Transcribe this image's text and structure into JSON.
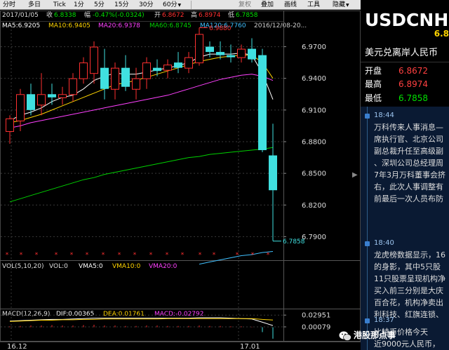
{
  "toolbar": {
    "items": [
      "分时",
      "多日",
      "Tick",
      "1分",
      "5分",
      "15分",
      "30分",
      "60分",
      "复权",
      "叠加",
      "画线",
      "工具",
      "隐藏"
    ]
  },
  "ohlc": {
    "date": "2017/01/05",
    "close_label": "收",
    "close": "6.8338",
    "change_label": "幅",
    "change": "-0.47%(-0.0324)",
    "open_label": "开",
    "open": "6.8672",
    "high_label": "高",
    "high": "6.8974",
    "low_label": "低",
    "low": "6.7858"
  },
  "ma": {
    "ma5": "MA5:6.9205",
    "ma10": "MA10:6.9405",
    "ma20": "MA20:6.9378",
    "ma60": "MA60:6.8745",
    "ma120": "MA120:6.7760",
    "range": "2016/12/08-20..."
  },
  "vol": {
    "title": "VOL(5,10,20)",
    "vol": "VOL:0",
    "vma5": "VMA5:0",
    "vma10": "VMA10:0",
    "vma20": "VMA20:0"
  },
  "macd": {
    "title": "MACD(12,26,9)",
    "dif": "DIF:0.00365",
    "dea": "DEA:0.01761",
    "macd": "MACD:-0.02792"
  },
  "colors": {
    "up": "#ff3030",
    "down": "#40e0e0",
    "ma5": "#ffffff",
    "ma10": "#ffd400",
    "ma20": "#ff40ff",
    "ma60": "#00d000",
    "ma120": "#40c0ff"
  },
  "chart_data": {
    "type": "candlestick",
    "price_axis_ticks": [
      "6.9700",
      "6.9400",
      "6.9100",
      "6.8800",
      "6.8500",
      "6.8200",
      "6.7900"
    ],
    "ylim": [
      6.775,
      6.985
    ],
    "macd_axis_ticks": [
      "0.02951",
      "0.00079"
    ],
    "x_labels": [
      "16.12",
      "17.01"
    ],
    "annotations": [
      {
        "text": "6.9880",
        "value": 6.988,
        "kind": "high"
      },
      {
        "text": "6.7858",
        "value": 6.7858,
        "kind": "low"
      }
    ],
    "candles": [
      {
        "o": 6.89,
        "h": 6.905,
        "l": 6.878,
        "c": 6.902
      },
      {
        "o": 6.9,
        "h": 6.93,
        "l": 6.89,
        "c": 6.925
      },
      {
        "o": 6.925,
        "h": 6.935,
        "l": 6.905,
        "c": 6.91
      },
      {
        "o": 6.915,
        "h": 6.945,
        "l": 6.905,
        "c": 6.925
      },
      {
        "o": 6.925,
        "h": 6.935,
        "l": 6.915,
        "c": 6.922
      },
      {
        "o": 6.922,
        "h": 6.932,
        "l": 6.915,
        "c": 6.925
      },
      {
        "o": 6.925,
        "h": 6.945,
        "l": 6.918,
        "c": 6.94
      },
      {
        "o": 6.94,
        "h": 6.96,
        "l": 6.935,
        "c": 6.955
      },
      {
        "o": 6.945,
        "h": 6.975,
        "l": 6.935,
        "c": 6.97
      },
      {
        "o": 6.95,
        "h": 6.968,
        "l": 6.92,
        "c": 6.93
      },
      {
        "o": 6.93,
        "h": 6.955,
        "l": 6.92,
        "c": 6.95
      },
      {
        "o": 6.95,
        "h": 6.962,
        "l": 6.928,
        "c": 6.932
      },
      {
        "o": 6.93,
        "h": 6.95,
        "l": 6.92,
        "c": 6.94
      },
      {
        "o": 6.94,
        "h": 6.96,
        "l": 6.93,
        "c": 6.955
      },
      {
        "o": 6.95,
        "h": 6.958,
        "l": 6.942,
        "c": 6.947
      },
      {
        "o": 6.948,
        "h": 6.958,
        "l": 6.94,
        "c": 6.953
      },
      {
        "o": 6.955,
        "h": 6.965,
        "l": 6.945,
        "c": 6.95
      },
      {
        "o": 6.95,
        "h": 6.965,
        "l": 6.945,
        "c": 6.96
      },
      {
        "o": 6.955,
        "h": 6.988,
        "l": 6.952,
        "c": 6.982
      },
      {
        "o": 6.97,
        "h": 6.975,
        "l": 6.96,
        "c": 6.965
      },
      {
        "o": 6.965,
        "h": 6.975,
        "l": 6.958,
        "c": 6.962
      },
      {
        "o": 6.962,
        "h": 6.972,
        "l": 6.955,
        "c": 6.96
      },
      {
        "o": 6.96,
        "h": 6.972,
        "l": 6.955,
        "c": 6.968
      },
      {
        "o": 6.968,
        "h": 6.978,
        "l": 6.955,
        "c": 6.958
      },
      {
        "o": 6.962,
        "h": 6.968,
        "l": 6.87,
        "c": 6.872
      },
      {
        "o": 6.867,
        "h": 6.897,
        "l": 6.786,
        "c": 6.834
      }
    ],
    "series": [
      {
        "name": "MA5",
        "values": [
          6.9,
          6.905,
          6.908,
          6.912,
          6.918,
          6.922,
          6.924,
          6.93,
          6.938,
          6.942,
          6.945,
          6.944,
          6.944,
          6.946,
          6.948,
          6.95,
          6.952,
          6.955,
          6.96,
          6.963,
          6.963,
          6.963,
          6.964,
          6.962,
          6.945,
          6.92
        ]
      },
      {
        "name": "MA10",
        "values": [
          6.898,
          6.9,
          6.903,
          6.906,
          6.91,
          6.914,
          6.918,
          6.922,
          6.926,
          6.93,
          6.934,
          6.936,
          6.938,
          6.941,
          6.944,
          6.947,
          6.95,
          6.953,
          6.956,
          6.958,
          6.96,
          6.961,
          6.962,
          6.962,
          6.955,
          6.94
        ]
      },
      {
        "name": "MA20",
        "values": [
          6.893,
          6.895,
          6.898,
          6.9,
          6.902,
          6.904,
          6.906,
          6.908,
          6.91,
          6.912,
          6.914,
          6.916,
          6.918,
          6.92,
          6.922,
          6.924,
          6.927,
          6.93,
          6.933,
          6.936,
          6.939,
          6.941,
          6.943,
          6.944,
          6.942,
          6.938
        ]
      },
      {
        "name": "MA60",
        "values": [
          6.823,
          6.826,
          6.829,
          6.832,
          6.835,
          6.838,
          6.841,
          6.844,
          6.846,
          6.849,
          6.851,
          6.853,
          6.855,
          6.857,
          6.859,
          6.861,
          6.863,
          6.865,
          6.866,
          6.868,
          6.869,
          6.87,
          6.871,
          6.872,
          6.873,
          6.8745
        ]
      },
      {
        "name": "MA120",
        "values": [
          null,
          null,
          null,
          null,
          null,
          null,
          null,
          null,
          null,
          null,
          null,
          null,
          null,
          null,
          null,
          null,
          null,
          null,
          6.764,
          6.766,
          6.768,
          6.77,
          6.772,
          6.773,
          6.775,
          6.776
        ]
      }
    ],
    "macd_hist": [
      0.002,
      0.003,
      0.004,
      0.004,
      0.005,
      0.004,
      0.004,
      0.005,
      0.006,
      0.004,
      0.004,
      0.003,
      0.003,
      0.004,
      0.004,
      0.003,
      0.003,
      0.003,
      0.004,
      0.003,
      0.003,
      0.002,
      0.002,
      0.001,
      -0.012,
      -0.028
    ],
    "dif": [
      0.015,
      0.016,
      0.017,
      0.018,
      0.019,
      0.019,
      0.02,
      0.021,
      0.022,
      0.022,
      0.022,
      0.022,
      0.022,
      0.022,
      0.022,
      0.022,
      0.022,
      0.022,
      0.023,
      0.023,
      0.023,
      0.022,
      0.021,
      0.02,
      0.012,
      0.004
    ],
    "dea": [
      0.014,
      0.015,
      0.016,
      0.017,
      0.017,
      0.018,
      0.018,
      0.019,
      0.019,
      0.02,
      0.02,
      0.02,
      0.02,
      0.02,
      0.02,
      0.021,
      0.021,
      0.021,
      0.021,
      0.021,
      0.021,
      0.021,
      0.021,
      0.021,
      0.019,
      0.0176
    ],
    "macd_ylim": [
      -0.03,
      0.035
    ]
  },
  "quote": {
    "symbol": "USDCNH",
    "price_partial": "6.8",
    "name": "美元兑离岸人民币",
    "rows": [
      {
        "label": "开盘",
        "value": "6.8672",
        "color": "up"
      },
      {
        "label": "最高",
        "value": "6.8974",
        "color": "up"
      },
      {
        "label": "最低",
        "value": "6.7858",
        "color": "down"
      }
    ]
  },
  "news": [
    {
      "time": "18:44",
      "lines": [
        "万科传来人事消息—",
        "席执行官、北京公司",
        "副总裁升任至高级副",
        "、深圳公司总经理周",
        "7年3月万科董事会挤",
        "右，此次人事调整有",
        "前最后一次人员布防"
      ]
    },
    {
      "time": "18:40",
      "lines": [
        "龙虎榜数据显示，16",
        "的身影，其中5只股",
        "11只股票呈现机构净",
        "买入前三分别是大庆",
        "百合花，机构净卖出",
        "利科技、红旗连锁、"
      ]
    },
    {
      "time": "18:37",
      "lines": [
        "比特币价格今天",
        "近9000元人民币，"
      ]
    }
  ],
  "watermark": {
    "text": "港股那点事"
  }
}
